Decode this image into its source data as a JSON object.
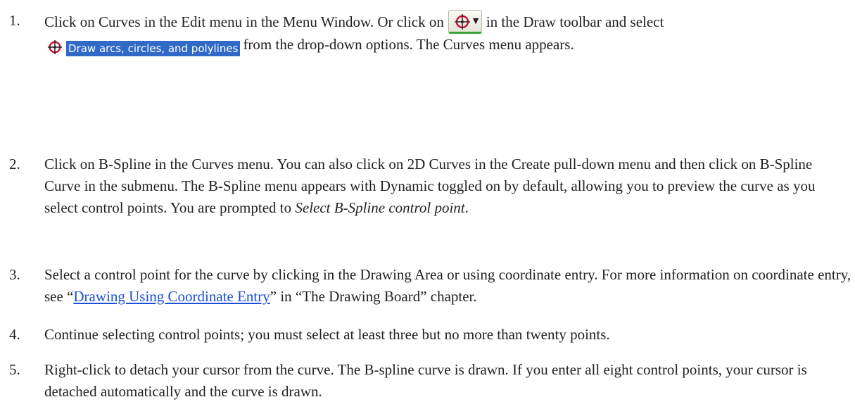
{
  "steps": [
    {
      "number": "1.",
      "part1": "Click on Curves in the Edit menu in the Menu Window. Or click on",
      "part2": "in the Draw toolbar and select",
      "menu_item_label": "Draw arcs, circles, and polylines",
      "part3": "from the drop-down options. The Curves menu appears."
    },
    {
      "number": "2.",
      "part1": "Click on B-Spline in the Curves menu. You can also click on 2D Curves in the Create pull-down menu and then click on B-Spline Curve in the submenu. The B-Spline menu appears with Dynamic toggled on by default, allowing you to preview the curve as you select control points. You are prompted to",
      "prompt": "Select B-Spline control point",
      "part2": "."
    },
    {
      "number": "3.",
      "part1": "Select a control point for the curve by clicking in the Drawing Area or using coordinate entry. For more information on coordinate entry, see “",
      "link": "Drawing Using Coordinate Entry",
      "part2": "” in “The Drawing Board” chapter."
    },
    {
      "number": "4.",
      "text": "Continue selecting control points; you must select at least three but no more than twenty points."
    },
    {
      "number": "5.",
      "text": "Right-click to detach your cursor from the curve. The B-spline curve is drawn. If you enter all eight control points, your cursor is detached automatically and the curve is drawn."
    }
  ],
  "icons": {
    "toolbar_button": "draw-curves-icon",
    "caret": "chevron-down-icon",
    "menu_icon": "draw-curves-icon"
  },
  "colors": {
    "link": "#1a4fd6",
    "selection": "#3169c6",
    "icon_red": "#c8102e",
    "toolbar_underline": "#37a33a"
  }
}
